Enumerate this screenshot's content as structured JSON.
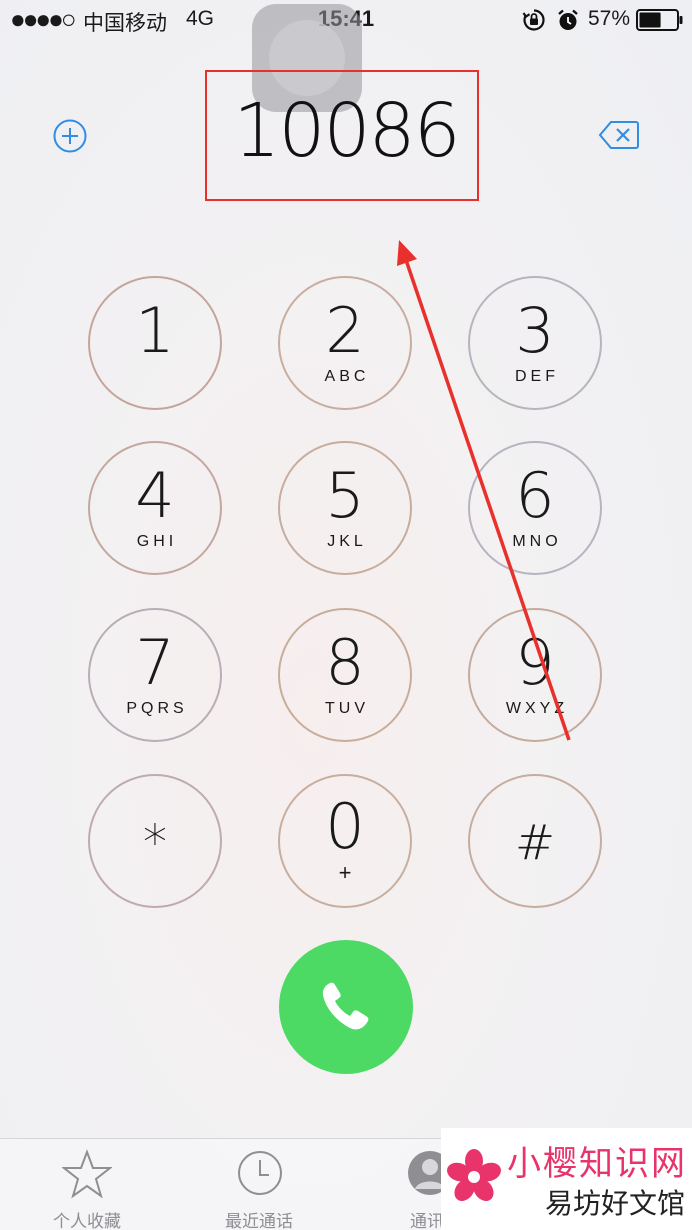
{
  "status_bar": {
    "signal": "●●●●○",
    "carrier": "中国移动",
    "network": "4G",
    "time": "15:41",
    "battery_percent": "57%",
    "battery_level": 0.57
  },
  "dialer": {
    "number": "10086"
  },
  "keypad": [
    {
      "digit": "1",
      "letters": ""
    },
    {
      "digit": "2",
      "letters": "ABC"
    },
    {
      "digit": "3",
      "letters": "DEF"
    },
    {
      "digit": "4",
      "letters": "GHI"
    },
    {
      "digit": "5",
      "letters": "JKL"
    },
    {
      "digit": "6",
      "letters": "MNO"
    },
    {
      "digit": "7",
      "letters": "PQRS"
    },
    {
      "digit": "8",
      "letters": "TUV"
    },
    {
      "digit": "9",
      "letters": "WXYZ"
    },
    {
      "digit": "*",
      "letters": ""
    },
    {
      "digit": "0",
      "letters": "+"
    },
    {
      "digit": "#",
      "letters": ""
    }
  ],
  "tabs": [
    {
      "label": "个人收藏",
      "icon": "star-icon"
    },
    {
      "label": "最近通话",
      "icon": "clock-icon"
    },
    {
      "label": "通讯",
      "icon": "contacts-icon"
    }
  ],
  "watermark": {
    "line1": "小樱知识网",
    "line2": "易坊好文馆"
  },
  "colors": {
    "accent": "#2f8de4",
    "call_green": "#4cd964",
    "annotation_red": "#e8302c",
    "watermark_pink": "#e8336b"
  }
}
